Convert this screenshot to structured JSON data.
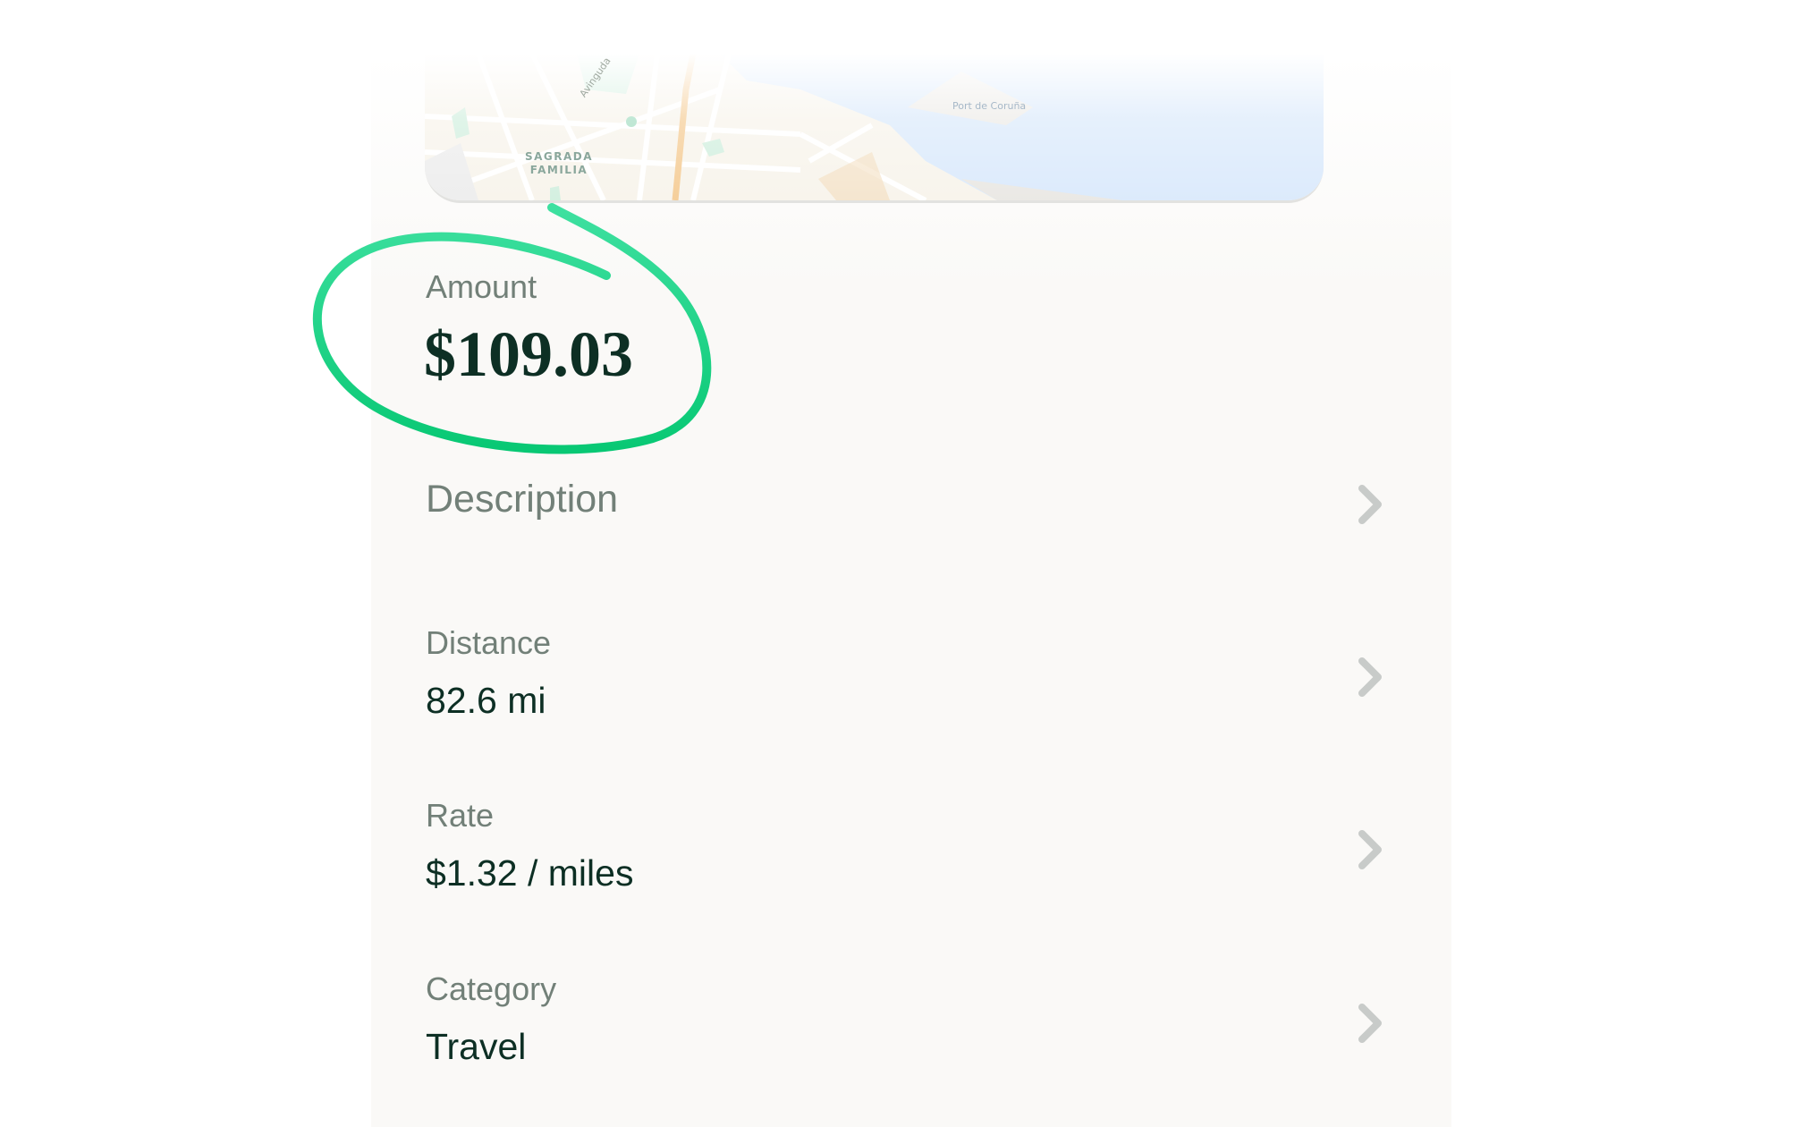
{
  "map": {
    "district_label_line1": "SAGRADA",
    "district_label_line2": "FAMILIA",
    "port_label": "Port de Coruña",
    "street_label": "Avinguda",
    "water_color": "#d8e8fb",
    "park_color": "#cfeedd"
  },
  "amount": {
    "label": "Amount",
    "value": "$109.03",
    "highlight_color": "#12d17e"
  },
  "description": {
    "label": "Description"
  },
  "distance": {
    "label": "Distance",
    "value": "82.6 mi"
  },
  "rate": {
    "label": "Rate",
    "value": "$1.32 / miles"
  },
  "category": {
    "label": "Category",
    "value": "Travel"
  },
  "icons": {
    "row_chevron": "chevron-right-icon"
  }
}
